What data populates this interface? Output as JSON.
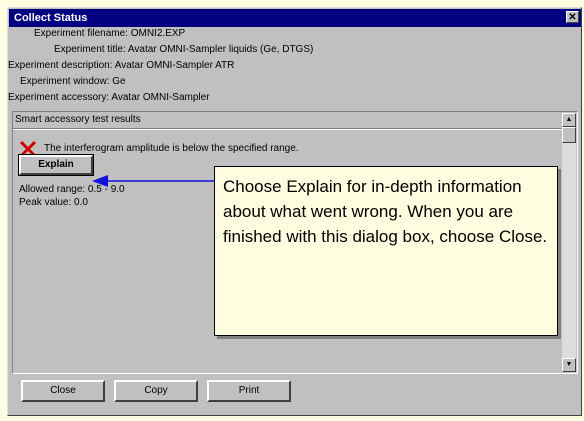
{
  "window": {
    "title": "Collect Status",
    "close_glyph": "✕"
  },
  "experiment": {
    "filename": "Experiment filename: OMNI2.EXP",
    "title": "Experiment title: Avatar OMNI-Sampler liquids (Ge, DTGS)",
    "description": "Experiment description: Avatar OMNI-Sampler ATR",
    "window": "Experiment window: Ge",
    "accessory": "Experiment accessory: Avatar OMNI-Sampler"
  },
  "results": {
    "header": "Smart accessory test results",
    "error_icon": "red-x-icon",
    "message": "The interferogram amplitude is below the specified range.",
    "explain_label": "Explain",
    "allowed_range": "Allowed range:   0.5 -  9.0",
    "peak_value": "Peak value:   0.0"
  },
  "buttons": {
    "close_label": "Close",
    "copy_label": "Copy",
    "print_label": "Print"
  },
  "callout": {
    "text": "Choose Explain for in-depth information about what went wrong. When you are finished with this dialog box, choose Close."
  },
  "colors": {
    "page_background": "#fffde0",
    "titlebar": "#000080",
    "dialog_face": "#c0c0c0",
    "error_red": "#cc0000",
    "arrow_blue": "#1010e0"
  }
}
